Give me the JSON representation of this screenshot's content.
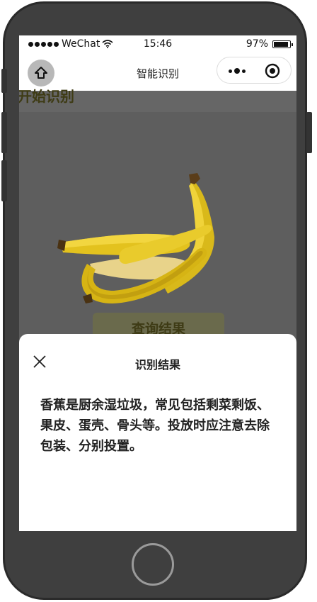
{
  "status_bar": {
    "carrier": "WeChat",
    "time": "15:46",
    "battery": "97%",
    "battery_level": 0.97
  },
  "nav": {
    "title": "智能识别"
  },
  "page": {
    "heading": "开始识别",
    "query_button_label": "查询结果"
  },
  "result_sheet": {
    "title": "识别结果",
    "text": "香蕉是厨余湿垃圾，常见包括剩菜剩饭、果皮、蛋壳、骨头等。投放时应注意去除包装、分别投置。"
  },
  "colors": {
    "overlay": "#5e5e5e",
    "banana": "#e3c21e",
    "phone_frame": "#3f3f3f"
  }
}
